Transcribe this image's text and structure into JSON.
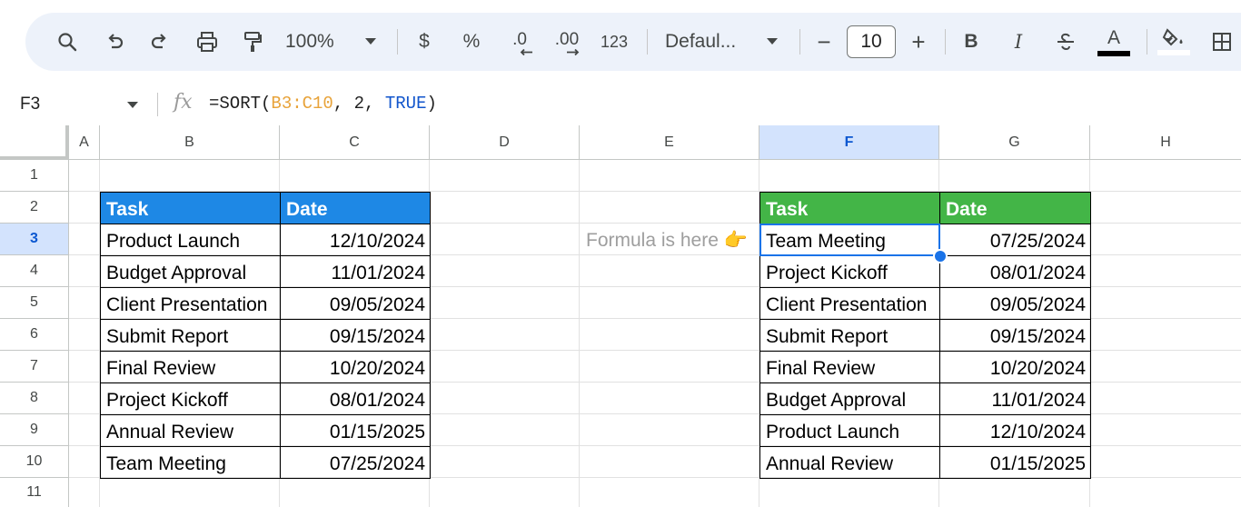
{
  "toolbar": {
    "zoom": "100%",
    "currency": "$",
    "percent": "%",
    "dec_decrease": ".0",
    "dec_increase": ".00",
    "number_format": "123",
    "font": "Defaul...",
    "font_size": "10",
    "minus": "−",
    "plus": "+",
    "bold": "B",
    "italic": "I",
    "text_color_letter": "A"
  },
  "formula_bar": {
    "cell_ref": "F3",
    "fx": "fx",
    "formula_prefix": "=SORT(",
    "formula_range": "B3:C10",
    "formula_mid": ", 2, ",
    "formula_bool": "TRUE",
    "formula_suffix": ")"
  },
  "columns": [
    "A",
    "B",
    "C",
    "D",
    "E",
    "F",
    "G",
    "H"
  ],
  "rows": [
    "1",
    "2",
    "3",
    "4",
    "5",
    "6",
    "7",
    "8",
    "9",
    "10",
    "11"
  ],
  "source_table": {
    "headers": [
      "Task",
      "Date"
    ],
    "rows": [
      [
        "Product Launch",
        "12/10/2024"
      ],
      [
        "Budget Approval",
        "11/01/2024"
      ],
      [
        "Client Presentation",
        "09/05/2024"
      ],
      [
        "Submit Report",
        "09/15/2024"
      ],
      [
        "Final Review",
        "10/20/2024"
      ],
      [
        "Project Kickoff",
        "08/01/2024"
      ],
      [
        "Annual Review",
        "01/15/2025"
      ],
      [
        "Team Meeting",
        "07/25/2024"
      ]
    ]
  },
  "sorted_table": {
    "headers": [
      "Task",
      "Date"
    ],
    "rows": [
      [
        "Team Meeting",
        "07/25/2024"
      ],
      [
        "Project Kickoff",
        "08/01/2024"
      ],
      [
        "Client Presentation",
        "09/05/2024"
      ],
      [
        "Submit Report",
        "09/15/2024"
      ],
      [
        "Final Review",
        "10/20/2024"
      ],
      [
        "Budget Approval",
        "11/01/2024"
      ],
      [
        "Product Launch",
        "12/10/2024"
      ],
      [
        "Annual Review",
        "01/15/2025"
      ]
    ]
  },
  "note": "Formula is here 👉",
  "colors": {
    "source_header": "#1e88e5",
    "sorted_header": "#43b547",
    "selection": "#1a73e8",
    "formula_range": "#e8a33a",
    "formula_bool": "#1155cc"
  }
}
